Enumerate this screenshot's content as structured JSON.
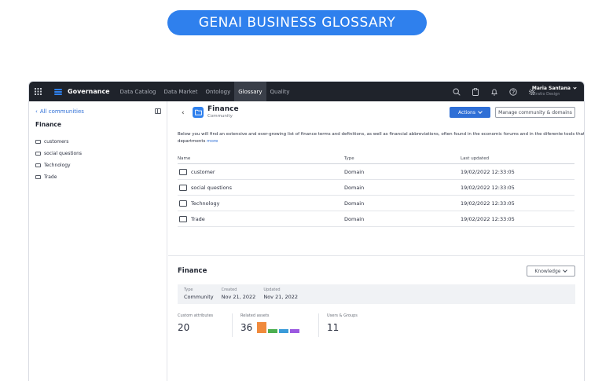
{
  "banner": {
    "title": "GENAI BUSINESS GLOSSARY"
  },
  "topbar": {
    "brand": "Governance",
    "nav": [
      "Data Catalog",
      "Data Market",
      "Ontology",
      "Glossary",
      "Quality"
    ],
    "active_nav": "Glossary",
    "user": {
      "name": "Maria Santana",
      "subtitle": "Stratio Design"
    }
  },
  "sidebar": {
    "back_label": "All communities",
    "title": "Finance",
    "items": [
      "customers",
      "social questions",
      "Technology",
      "Trade"
    ]
  },
  "header": {
    "title": "Finance",
    "subtitle": "Community",
    "actions_label": "Actions",
    "manage_label": "Manage community & domains"
  },
  "description": {
    "text": "Below you will find an extensive and ever-growing list of finance terms and definitions, as well as financial abbreviations, often found in the economic forums and in the diferente tools that departments",
    "more": "more"
  },
  "table": {
    "headers": [
      "Name",
      "Type",
      "Last updated"
    ],
    "rows": [
      {
        "name": "customer",
        "type": "Domain",
        "updated": "19/02/2022 12:33:05"
      },
      {
        "name": "social questions",
        "type": "Domain",
        "updated": "19/02/2022 12:33:05"
      },
      {
        "name": "Technology",
        "type": "Domain",
        "updated": "19/02/2022 12:33:05"
      },
      {
        "name": "Trade",
        "type": "Domain",
        "updated": "19/02/2022 12:33:05"
      }
    ]
  },
  "details": {
    "title": "Finance",
    "knowledge_label": "Knowledge",
    "meta": [
      {
        "label": "Type",
        "value": "Community"
      },
      {
        "label": "Created",
        "value": "Nov 21, 2022"
      },
      {
        "label": "Updated",
        "value": "Nov 21, 2022"
      }
    ],
    "stats": [
      {
        "label": "Custom attributes",
        "value": "20"
      },
      {
        "label": "Related assets",
        "value": "36"
      },
      {
        "label": "Users & Groups",
        "value": "11"
      }
    ],
    "asset_bars": [
      {
        "color": "#f08a3c",
        "level": 1.0
      },
      {
        "color": "#4caf50",
        "level": 0.35
      },
      {
        "color": "#3a9bd9",
        "level": 0.35
      },
      {
        "color": "#9b59e0",
        "level": 0.35
      }
    ]
  },
  "colors": {
    "accent": "#2f80ed",
    "topbar": "#1f232b"
  }
}
